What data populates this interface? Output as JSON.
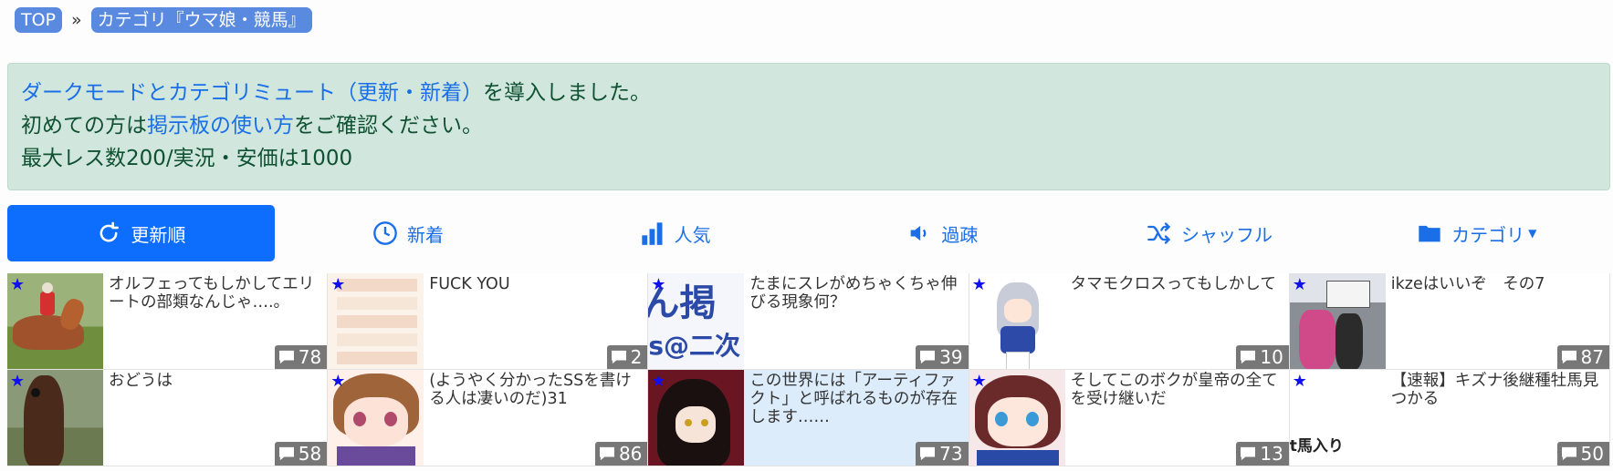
{
  "breadcrumb": {
    "top": "TOP",
    "sep": "»",
    "category": "カテゴリ『ウマ娘・競馬』"
  },
  "notice": {
    "line1_link": "ダークモードとカテゴリミュート（更新・新着）",
    "line1_rest": "を導入しました。",
    "line2_pre": "初めての方は",
    "line2_link": "掲示板の使い方",
    "line2_post": "をご確認ください。",
    "line3": "最大レス数200/実況・安価は1000"
  },
  "tabs": [
    {
      "label": "更新順",
      "icon": "refresh-icon"
    },
    {
      "label": "新着",
      "icon": "clock-icon"
    },
    {
      "label": "人気",
      "icon": "bar-chart-icon"
    },
    {
      "label": "過疎",
      "icon": "speaker-icon"
    },
    {
      "label": "シャッフル",
      "icon": "shuffle-icon"
    },
    {
      "label": "カテゴリ",
      "icon": "folder-icon"
    }
  ],
  "threads": [
    {
      "title": "オルフェってもしかしてエリートの部類なんじゃ….。",
      "count": "78"
    },
    {
      "title": "FUCK YOU",
      "count": "2"
    },
    {
      "title": "たまにスレがめちゃくちゃ伸びる現象何？",
      "count": "39",
      "thumb_text1": "ん掲",
      "thumb_text2": "s@二次"
    },
    {
      "title": "タマモクロスってもしかして",
      "count": "10"
    },
    {
      "title": "ikzeはいいぞ　その7",
      "count": "87"
    },
    {
      "title": "おどうは",
      "count": "58"
    },
    {
      "title": "(ようやく分かったSSを書ける人は凄いのだ)31",
      "count": "86"
    },
    {
      "title": "この世界には「アーティファクト」と呼ばれるものが存在します……",
      "count": "73"
    },
    {
      "title": "そしてこのボクが皇帝の全てを受け継いだ",
      "count": "13"
    },
    {
      "title": "【速報】キズナ後継種牡馬見つかる",
      "count": "50",
      "thumb_text1": "t馬入り"
    }
  ],
  "colors": {
    "accent": "#0d6efd",
    "notice_bg": "#d1e7dd",
    "crumb": "#5a8ae0",
    "star": "#1010ee"
  }
}
